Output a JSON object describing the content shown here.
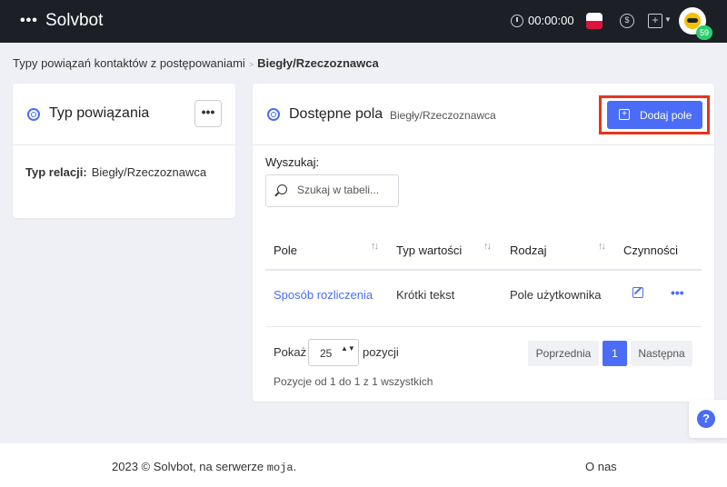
{
  "header": {
    "brand": "Solvbot",
    "timer": "00:00:00",
    "badge_count": "59"
  },
  "breadcrumb": {
    "parent": "Typy powiązań kontaktów z postępowaniami",
    "separator": ">",
    "current": "Biegły/Rzeczoznawca"
  },
  "left_card": {
    "title": "Typ powiązania",
    "more_label": "•••",
    "relation_label": "Typ relacji:",
    "relation_value": "Biegły/Rzeczoznawca"
  },
  "right_card": {
    "title": "Dostępne pola",
    "subtitle": "Biegły/Rzeczoznawca",
    "add_button": "Dodaj pole",
    "search_label": "Wyszukaj:",
    "search_placeholder": "Szukaj w tabeli...",
    "columns": [
      "Pole",
      "Typ wartości",
      "Rodzaj",
      "Czynności"
    ],
    "sort_glyph": "↑↓",
    "rows": [
      {
        "pole": "Sposób rozliczenia",
        "typ": "Krótki tekst",
        "rodzaj": "Pole użytkownika",
        "more": "•••"
      }
    ],
    "show_label": "Pokaż",
    "page_size": "25",
    "page_size_arrows": "▲▼",
    "positions_label": "pozycji",
    "info": "Pozycje od 1 do 1 z 1 wszystkich",
    "prev": "Poprzednia",
    "current_page": "1",
    "next": "Następna"
  },
  "help": {
    "label": "?"
  },
  "footer": {
    "copyright_prefix": "2023 © Solvbot, na serwerze",
    "server": "moja",
    "suffix": ".",
    "about": "O nas"
  },
  "colors": {
    "accent": "#4a6cf7",
    "topbar": "#1c1f26",
    "highlight": "#e8341c"
  }
}
